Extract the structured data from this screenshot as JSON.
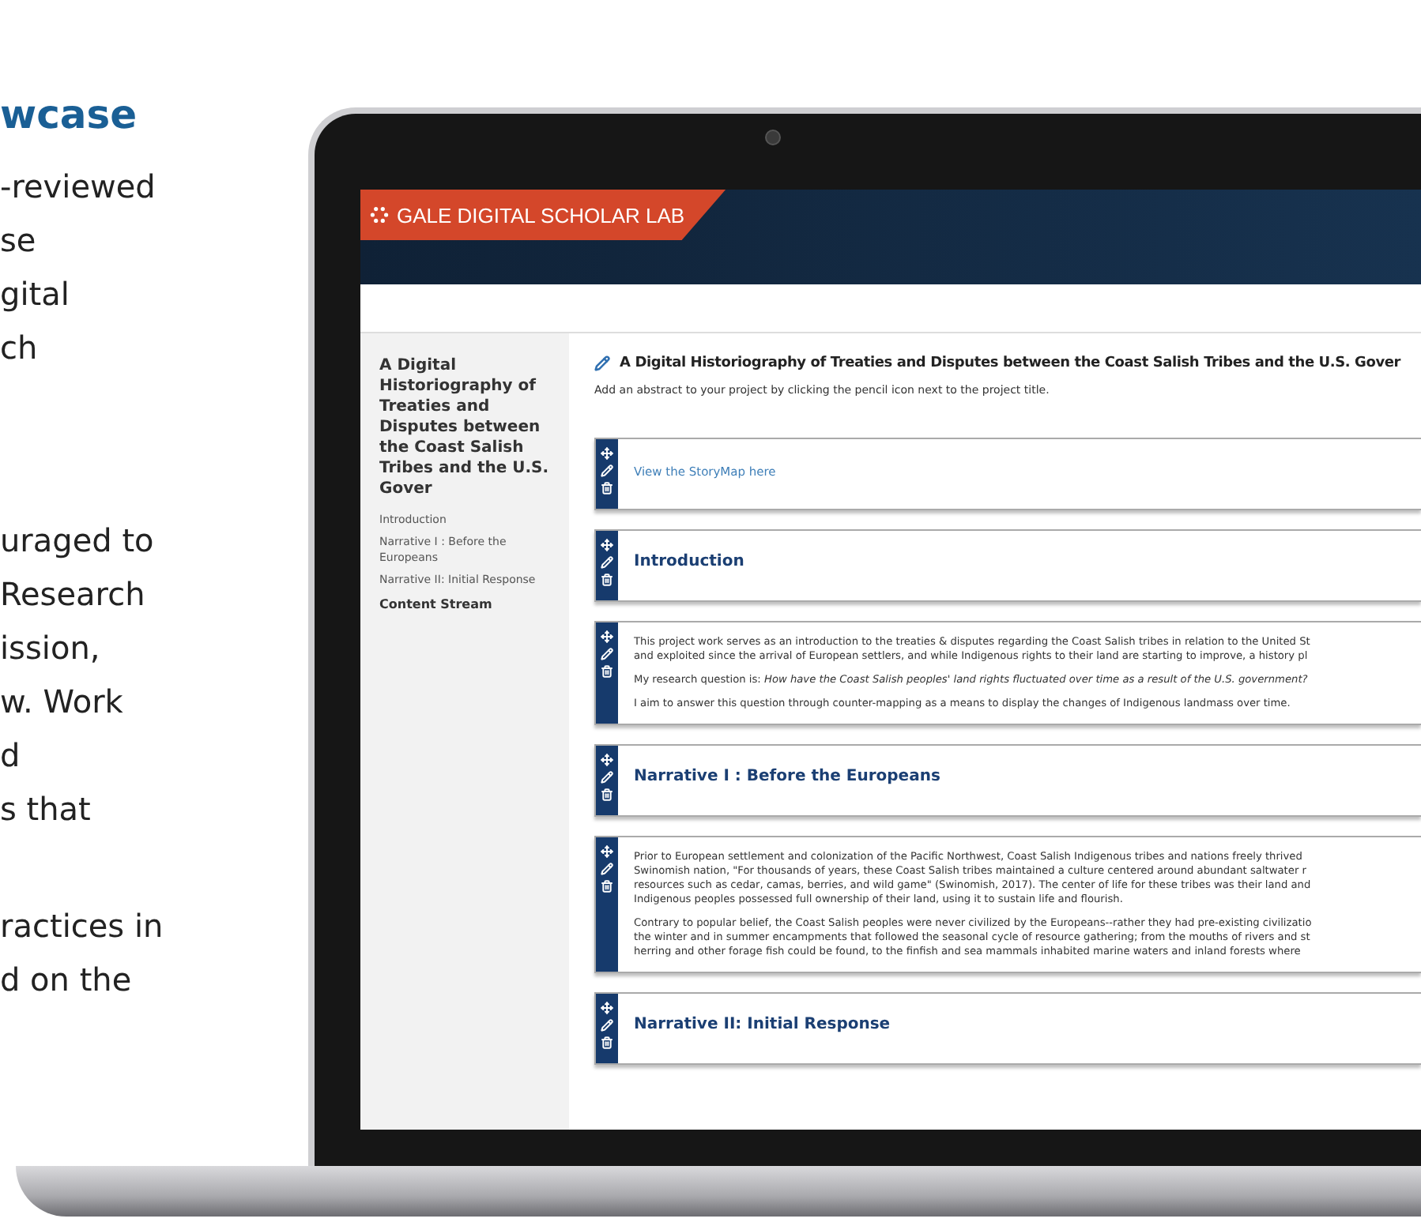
{
  "intro": {
    "heading": "wcase",
    "paragraphs": [
      [
        "-reviewed",
        "se",
        "gital",
        "ch"
      ],
      [
        "uraged to",
        "Research",
        "ission,",
        "w. Work",
        "d",
        "s that"
      ],
      [
        "ractices in",
        "d on the"
      ]
    ]
  },
  "app": {
    "logo": "GALE DIGITAL SCHOLAR LAB",
    "sidebar": {
      "title": "A Digital Historiography of Treaties and Disputes between the Coast Salish Tribes and the U.S. Gover",
      "links": [
        "Introduction",
        "Narrative I : Before the Europeans",
        "Narrative II: Initial Response"
      ],
      "section": "Content Stream"
    },
    "project": {
      "title": "A Digital Historiography of Treaties and Disputes between the Coast Salish Tribes and the U.S. Gover",
      "abstract_hint": "Add an abstract to your project by clicking the pencil icon next to the project title."
    },
    "cards": [
      {
        "kind": "link",
        "text": "View the StoryMap here"
      },
      {
        "kind": "heading",
        "text": "Introduction"
      },
      {
        "kind": "text",
        "paragraphs": [
          [
            "This project work serves as an introduction to the treaties & disputes regarding the Coast Salish tribes in relation to the United St",
            "and exploited since the arrival of European settlers, and while Indigenous rights to their land are starting to improve, a history pl"
          ],
          [
            "My research question is: *How have the Coast Salish peoples' land rights fluctuated over time as a result of the U.S. government?*"
          ],
          [
            "I aim to answer this question through counter-mapping as a means to display the changes of Indigenous landmass over time."
          ]
        ]
      },
      {
        "kind": "heading",
        "text": "Narrative I : Before the Europeans"
      },
      {
        "kind": "text",
        "paragraphs": [
          [
            "Prior to European settlement and colonization of the Pacific Northwest, Coast Salish Indigenous tribes and nations freely thrived",
            "Swinomish nation, \"For thousands of years, these Coast Salish tribes maintained a culture centered around abundant saltwater r",
            "resources such as cedar, camas, berries, and wild game\" (Swinomish, 2017). The center of life for these tribes was their land and",
            "Indigenous peoples possessed full ownership of their land, using it to sustain life and flourish."
          ],
          [
            "Contrary to popular belief, the Coast Salish peoples were never civilized by the Europeans--rather they had pre-existing civilizatio",
            "the winter and in summer encampments that followed the seasonal cycle of resource gathering; from the mouths of rivers and st",
            "herring and other forage fish could be found, to the finfish and sea mammals inhabited marine waters and inland forests where"
          ]
        ]
      },
      {
        "kind": "heading",
        "text": "Narrative II: Initial Response"
      }
    ]
  }
}
